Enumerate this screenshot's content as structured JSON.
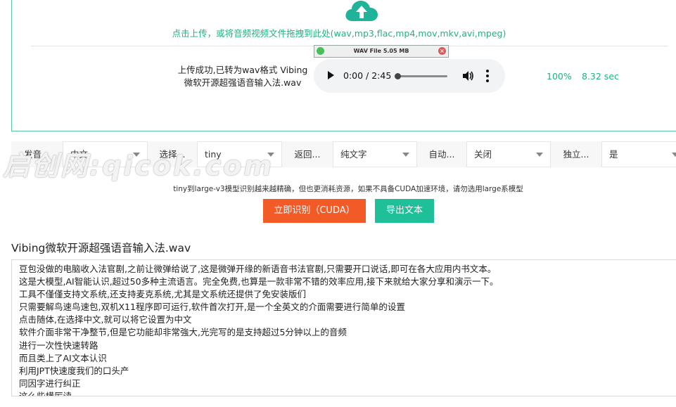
{
  "upload": {
    "hint": "点击上传，或将音频视频文件拖拽到此处(wav,mp3,flac,mp4,mov,mkv,avi,mpeg)",
    "badge": "WAV File 5.05 MB",
    "badge_close": "×",
    "status_line1": "上传成功,已转为wav格式 Vibing",
    "status_line2": "微软开源超强语音输入法.wav",
    "player_time": "0:00 / 2:45",
    "progress": "100%",
    "duration": "8.32 sec",
    "colors": {
      "accent": "#1fb37d",
      "border": "#5cc79d"
    }
  },
  "options": [
    {
      "label": "发音...",
      "value": "中文"
    },
    {
      "label": "选择...",
      "value": "tiny"
    },
    {
      "label": "返回...",
      "value": "纯文字"
    },
    {
      "label": "自动...",
      "value": "关闭"
    },
    {
      "label": "独立...",
      "value": "是"
    }
  ],
  "watermark": "启创网:qicok.com",
  "model_note": "tiny到large-v3模型识别越来越精确，但也更消耗资源，如果不具备CUDA加速环境，请勿选用large系模型",
  "buttons": {
    "recognize": "立即识别（CUDA）",
    "export": "导出文本",
    "colors": {
      "recognize": "#f25a27",
      "export": "#1fbf9a"
    }
  },
  "result": {
    "title": "Vibing微软开源超强语音输入法.wav",
    "lines": [
      "豆包没做的电脑收入法官剧,之前让微弹给说了,这是微弹开缘的新语音书法官剧,只需要开口说话,即可在各大应用内书文本。",
      "这是大模型,AI智能认识,超过50多种主流语言。完全免费,也算是一款非常不错的效率应用,接下来就给大家分享和演示一下。",
      "工具不僅僅支持文系统,还支持麦克系统,尤其是文系统还提供了免安装版们",
      "只需要解鸟速鸟速包,双机X11程序即可运行,软件首次打开,是一个全英文的介面需要进行简单的设置",
      "点击随体,在选择中文,就可以将它设置为中文",
      "软件介面非常干净整节,但是它功能却非常強大,光完写的是支持超过5分钟以上的音频",
      "进行一次性快速转路",
      "而且类上了AI文本认识",
      "利用JPT快速度我们的口头产",
      "同因字进行纠正",
      "这么些横厉读"
    ]
  }
}
